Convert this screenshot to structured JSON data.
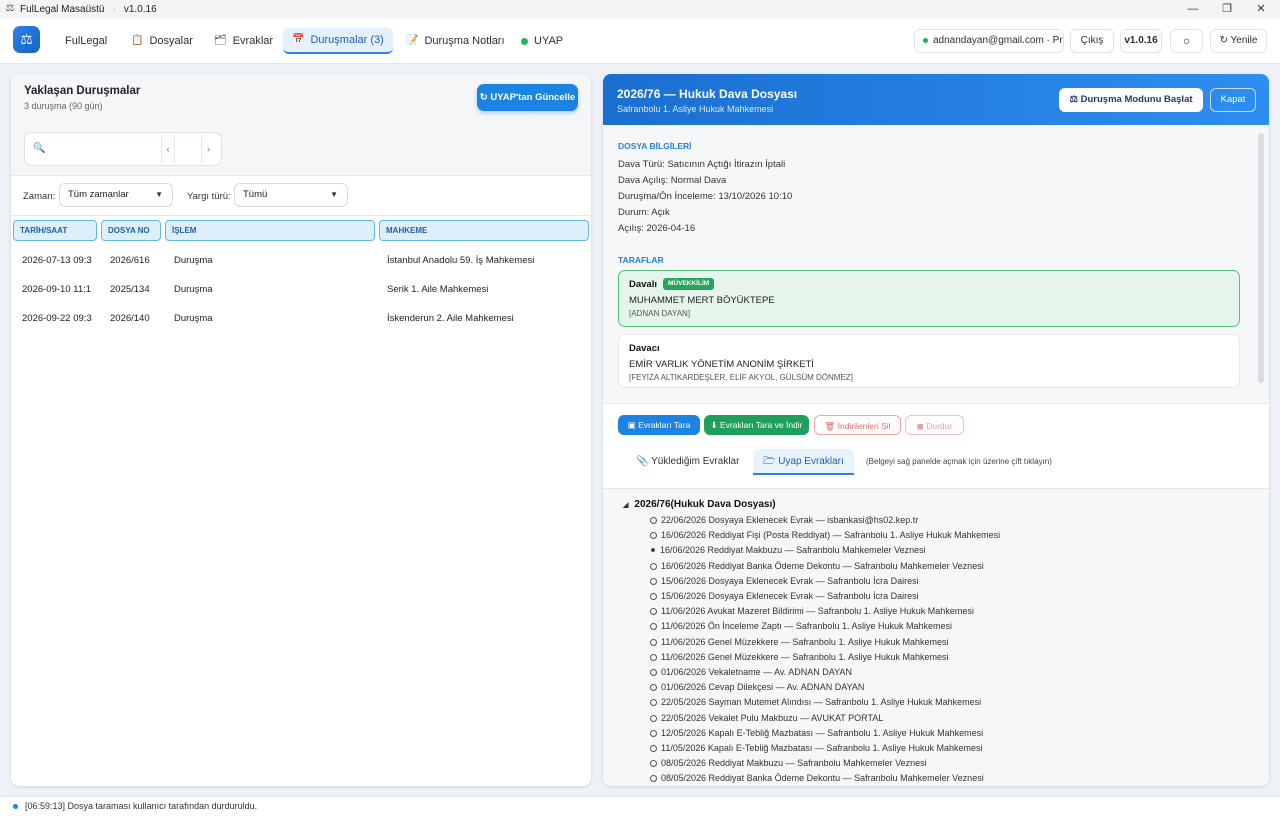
{
  "window": {
    "title": "FulLegal Masaüstü",
    "separator": "·",
    "version": "v1.0.16"
  },
  "nav": {
    "brand": "FulLegal",
    "items": [
      {
        "label": "Dosyalar",
        "icon": "clipboard-icon"
      },
      {
        "label": "Evraklar",
        "icon": "folder-icon"
      },
      {
        "label": "Duruşmalar (3)",
        "icon": "calendar-icon",
        "active": true
      },
      {
        "label": "Duruşma Notları",
        "icon": "note-edit-icon"
      },
      {
        "label": "UYAP",
        "icon": "status-dot-icon"
      }
    ],
    "user_email": "adnandayan@gmail.com · Pr...",
    "logout_label": "Çıkış",
    "version_label": "v1.0.16",
    "refresh_label": "Yenile"
  },
  "left": {
    "title": "Yaklaşan Duruşmalar",
    "subtitle": "3 duruşma (90 gün)",
    "update_button": "↻ UYAP'tan Güncelle",
    "search_value": "",
    "filters": {
      "time_label": "Zaman:",
      "time_value": "Tüm zamanlar",
      "jurisdiction_label": "Yargı türü:",
      "jurisdiction_value": "Tümü"
    },
    "columns": [
      "TARİH/SAAT",
      "DOSYA NO",
      "İŞLEM",
      "MAHKEME"
    ],
    "rows": [
      {
        "date": "2026-07-13 09:3",
        "no": "2026/616",
        "action": "Duruşma",
        "court": "İstanbul Anadolu 59. İş Mahkemesi"
      },
      {
        "date": "2026-09-10 11:1",
        "no": "2025/134",
        "action": "Duruşma",
        "court": "Serik 1. Aile Mahkemesi"
      },
      {
        "date": "2026-09-22 09:3",
        "no": "2026/140",
        "action": "Duruşma",
        "court": "İskenderun 2. Aile Mahkemesi"
      }
    ]
  },
  "right": {
    "title": "2026/76 — Hukuk Dava Dosyası",
    "subtitle": "Safranbolu 1. Asliye Hukuk Mahkemesi",
    "start_button": "Duruşma Modunu Başlat",
    "close_button": "Kapat",
    "file_info_label": "DOSYA BİLGİLERİ",
    "info": [
      "Dava Türü: Satıcının Açtığı İtirazın İptali",
      "Dava Açılış: Normal Dava",
      "Duruşma/Ön İnceleme: 13/10/2026 10:10",
      "Durum: Açık",
      "Açılış: 2026-04-16"
    ],
    "parties_label": "TARAFLAR",
    "defendant": {
      "role": "Davalı",
      "badge": "MÜVEKKİLİM",
      "name": "MUHAMMET MERT BÖYÜKTEPE",
      "lawyers": "[ADNAN DAYAN]"
    },
    "plaintiff": {
      "role": "Davacı",
      "name": "EMİR VARLIK YÖNETİM ANONİM ŞİRKETİ",
      "lawyers": "[FEYİZA ALTIKARDEŞLER, ELİF AKYOL, GÜLSÜM DÖNMEZ]"
    },
    "tools": {
      "scan": "Evrakları Tara",
      "scan_download": "Evrakları Tara ve İndir",
      "delete_downloaded": "İndirilenleri Sil",
      "stop": "Durdur"
    },
    "tabs": {
      "uploaded": "Yüklediğim Evraklar",
      "uyap": "Uyap Evrakları"
    },
    "hint": "(Belgeyi sağ panelde açmak için üzerine çift tıklayın)",
    "tree_root": "2026/76(Hukuk Dava Dosyası)",
    "documents": [
      {
        "text": "22/06/2026  Dosyaya Eklenecek Evrak  — isbankasi@hs02.kep.tr",
        "filled": false
      },
      {
        "text": "16/06/2026  Reddiyat Fişi (Posta Reddiyat)  — Safranbolu 1. Asliye Hukuk Mahkemesi",
        "filled": false
      },
      {
        "text": "16/06/2026  Reddiyat Makbuzu  — Safranbolu Mahkemeler Veznesi",
        "filled": true
      },
      {
        "text": "16/06/2026  Reddiyat Banka Ödeme Dekontu  — Safranbolu Mahkemeler Veznesi",
        "filled": false
      },
      {
        "text": "15/06/2026  Dosyaya Eklenecek Evrak  — Safranbolu İcra Dairesi",
        "filled": false
      },
      {
        "text": "15/06/2026  Dosyaya Eklenecek Evrak  — Safranbolu İcra Dairesi",
        "filled": false
      },
      {
        "text": "11/06/2026  Avukat Mazeret Bildirimi  — Safranbolu 1. Asliye Hukuk Mahkemesi",
        "filled": false
      },
      {
        "text": "11/06/2026  Ön İnceleme Zaptı  — Safranbolu 1. Asliye Hukuk Mahkemesi",
        "filled": false
      },
      {
        "text": "11/06/2026  Genel Müzekkere  — Safranbolu 1. Asliye Hukuk Mahkemesi",
        "filled": false
      },
      {
        "text": "11/06/2026  Genel Müzekkere  — Safranbolu 1. Asliye Hukuk Mahkemesi",
        "filled": false
      },
      {
        "text": "01/06/2026  Vekaletname  — Av. ADNAN DAYAN",
        "filled": false
      },
      {
        "text": "01/06/2026  Cevap Dilekçesi  — Av. ADNAN DAYAN",
        "filled": false
      },
      {
        "text": "22/05/2026  Sayman Mutemet Alındısı  — Safranbolu 1. Asliye Hukuk Mahkemesi",
        "filled": false
      },
      {
        "text": "22/05/2026  Vekalet Pulu Makbuzu  — AVUKAT PORTAL",
        "filled": false
      },
      {
        "text": "12/05/2026  Kapalı E-Tebliğ Mazbatası  — Safranbolu 1. Asliye Hukuk Mahkemesi",
        "filled": false
      },
      {
        "text": "11/05/2026  Kapalı E-Tebliğ Mazbatası  — Safranbolu 1. Asliye Hukuk Mahkemesi",
        "filled": false
      },
      {
        "text": "08/05/2026  Reddiyat Makbuzu  — Safranbolu Mahkemeler Veznesi",
        "filled": false
      },
      {
        "text": "08/05/2026  Reddiyat Banka Ödeme Dekontu  — Safranbolu Mahkemeler Veznesi",
        "filled": false
      }
    ]
  },
  "status": {
    "message": "[06:59:13] Dosya taraması kullanıcı tarafından durduruldu."
  },
  "colors": {
    "accent": "#1c83e0",
    "success": "#1f9e5c",
    "danger": "#e46a6a"
  }
}
